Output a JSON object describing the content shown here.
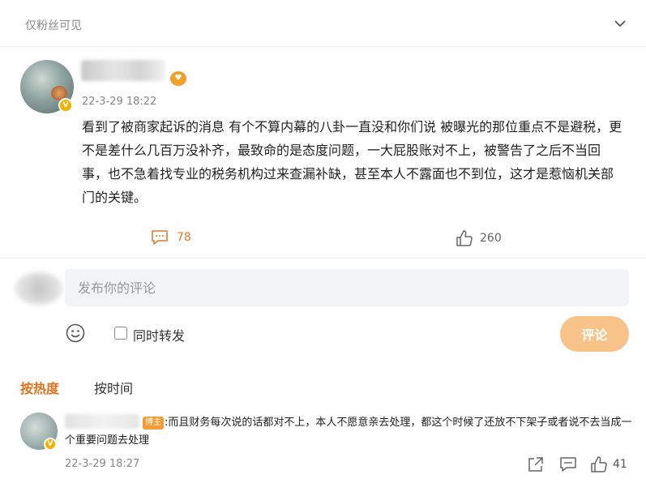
{
  "post": {
    "visibility": "仅粉丝可见",
    "time": "22-3-29 18:22",
    "body": "看到了被商家起诉的消息 有个不算内幕的八卦一直没和你们说  被曝光的那位重点不是避税，更不是差什么几百万没补齐，最致命的是态度问题，一大屁股账对不上，被警告了之后不当回事，也不急着找专业的税务机构过来查漏补缺，甚至本人不露面也不到位，这才是惹恼机关部门的关键。",
    "comment_count": "78",
    "like_count": "260",
    "verified_badge": "V",
    "fan_badge": "♥"
  },
  "reply": {
    "placeholder": "发布你的评论",
    "forward_label": "同时转发",
    "submit_label": "评论"
  },
  "sort": {
    "hot_label": "按热度",
    "time_label": "按时间"
  },
  "sub_comment": {
    "author_badge": "博主",
    "text": ":而且财务每次说的话都对不上，本人不愿意亲去处理，都这个时候了还放不下架子或者说不去当成一个重要问题去处理",
    "time": "22-3-29 18:27",
    "like_count": "41",
    "verified_badge": "V"
  },
  "icons": {
    "collapse": "chevron-down-icon",
    "comment": "comment-icon",
    "like": "thumbs-up-icon",
    "emoji": "smile-icon",
    "share": "share-icon"
  },
  "colors": {
    "accent": "#e2701a",
    "submit_bg": "#f7c389",
    "verified": "#f5b100"
  }
}
